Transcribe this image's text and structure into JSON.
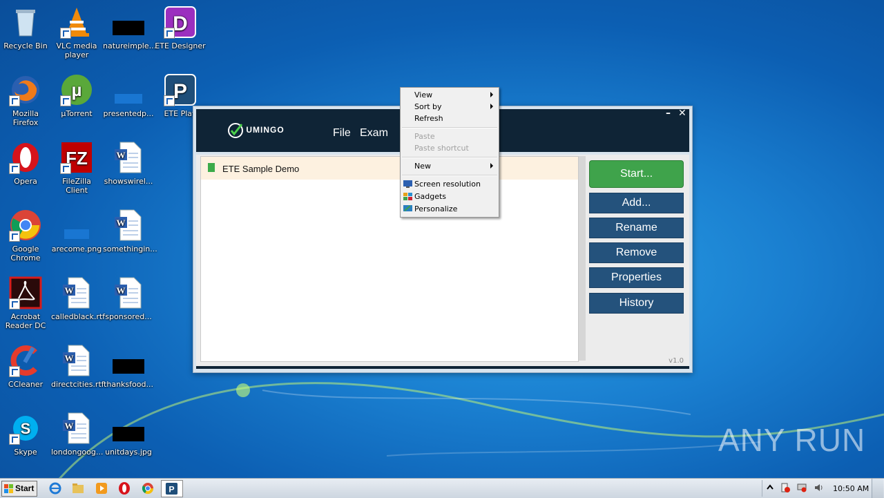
{
  "desktop": {
    "icons": [
      {
        "label": "Recycle Bin"
      },
      {
        "label": "VLC media player"
      },
      {
        "label": "natureimple..."
      },
      {
        "label": "ETE Designer"
      },
      {
        "label": "Mozilla Firefox"
      },
      {
        "label": "µTorrent"
      },
      {
        "label": "presentedp..."
      },
      {
        "label": "ETE Play"
      },
      {
        "label": "Opera"
      },
      {
        "label": "FileZilla Client"
      },
      {
        "label": "showswirel..."
      },
      {
        "label": "Google Chrome"
      },
      {
        "label": "arecome.png"
      },
      {
        "label": "somethingin..."
      },
      {
        "label": "Acrobat Reader DC"
      },
      {
        "label": "calledblack.rtf"
      },
      {
        "label": "sponsored..."
      },
      {
        "label": "CCleaner"
      },
      {
        "label": "directcities.rtf"
      },
      {
        "label": "thanksfood..."
      },
      {
        "label": "Skype"
      },
      {
        "label": "londongoog..."
      },
      {
        "label": "unitdays.jpg"
      }
    ]
  },
  "app": {
    "logo_text": "UMINGO",
    "menu": {
      "file": "File",
      "exam": "Exam"
    },
    "minimize": "–",
    "close": "✕",
    "exams": [
      {
        "name": "ETE Sample Demo"
      }
    ],
    "buttons": {
      "start": "Start...",
      "add": "Add...",
      "rename": "Rename",
      "remove": "Remove",
      "properties": "Properties",
      "history": "History"
    },
    "version": "v1.0"
  },
  "context_menu": {
    "view": "View",
    "sort_by": "Sort by",
    "refresh": "Refresh",
    "paste": "Paste",
    "paste_shortcut": "Paste shortcut",
    "new": "New",
    "screen_resolution": "Screen resolution",
    "gadgets": "Gadgets",
    "personalize": "Personalize"
  },
  "taskbar": {
    "start": "Start",
    "clock": "10:50 AM"
  },
  "watermark": "ANY RUN"
}
